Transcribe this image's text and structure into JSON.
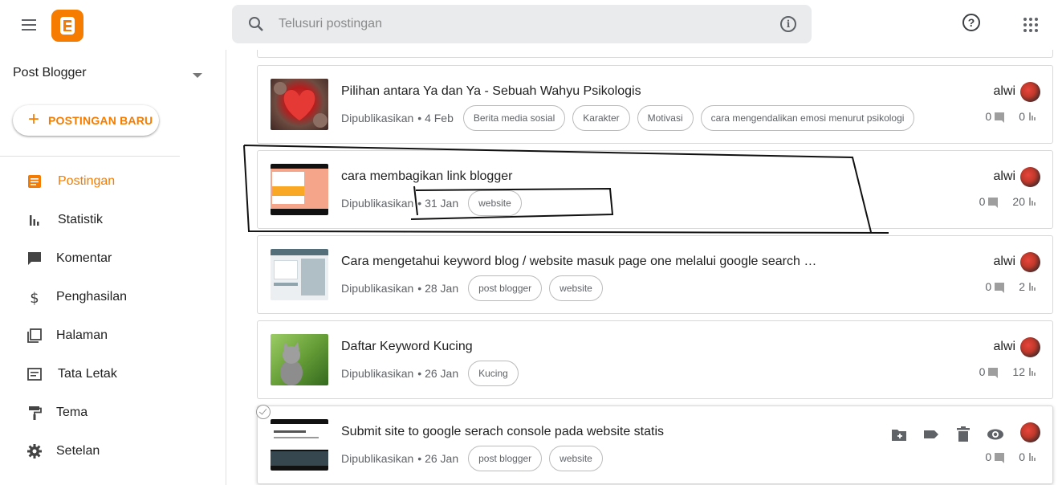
{
  "search": {
    "placeholder": "Telusuri postingan"
  },
  "sidebar": {
    "blog_name": "Post Blogger",
    "new_post_label": "POSTINGAN BARU",
    "items": [
      {
        "label": "Postingan",
        "icon": "posts-icon",
        "active": true
      },
      {
        "label": "Statistik",
        "icon": "stats-icon"
      },
      {
        "label": "Komentar",
        "icon": "comment-icon"
      },
      {
        "label": "Penghasilan",
        "icon": "dollar-icon"
      },
      {
        "label": "Halaman",
        "icon": "pages-icon"
      },
      {
        "label": "Tata Letak",
        "icon": "layout-icon"
      },
      {
        "label": "Tema",
        "icon": "paint-roller-icon"
      },
      {
        "label": "Setelan",
        "icon": "gear-icon"
      }
    ]
  },
  "posts": [
    {
      "title": "Pilihan antara Ya dan Ya - Sebuah Wahyu Psikologis",
      "status": "Dipublikasikan",
      "date": "• 4 Feb",
      "labels": [
        "Berita media sosial",
        "Karakter",
        "Motivasi",
        "cara mengendalikan emosi menurut psikologi"
      ],
      "author": "alwi",
      "comments": "0",
      "views": "0"
    },
    {
      "title": "cara membagikan link blogger",
      "status": "Dipublikasikan",
      "date": "• 31 Jan",
      "labels": [
        "website"
      ],
      "author": "alwi",
      "comments": "0",
      "views": "20"
    },
    {
      "title": "Cara mengetahui keyword blog / website masuk page one melalui google search …",
      "status": "Dipublikasikan",
      "date": "• 28 Jan",
      "labels": [
        "post blogger",
        "website"
      ],
      "author": "alwi",
      "comments": "0",
      "views": "2"
    },
    {
      "title": "Daftar Keyword Kucing",
      "status": "Dipublikasikan",
      "date": "• 26 Jan",
      "labels": [
        "Kucing"
      ],
      "author": "alwi",
      "comments": "0",
      "views": "12"
    },
    {
      "title": "Submit site to google serach console pada website statis",
      "status": "Dipublikasikan",
      "date": "• 26 Jan",
      "labels": [
        "post blogger",
        "website"
      ],
      "comments": "0",
      "views": "0"
    }
  ],
  "colors": {
    "accent": "#f57c00",
    "search_bg": "#e9ebed",
    "border": "#d8d8d8"
  }
}
